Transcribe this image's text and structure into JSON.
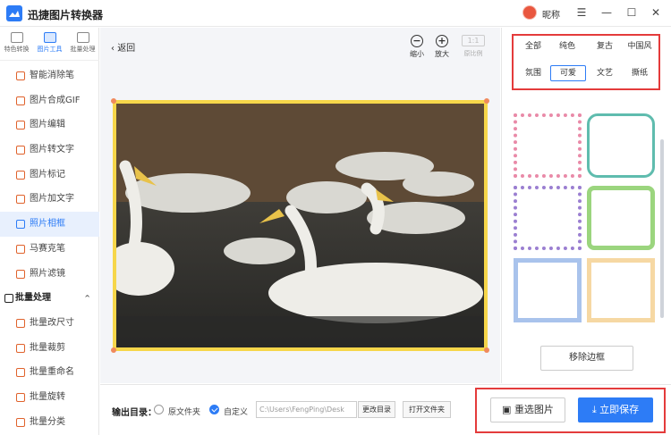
{
  "app": {
    "title": "迅捷图片转换器",
    "nickname": "昵称"
  },
  "window": {
    "menu_icon": "☰",
    "minimize_icon": "—",
    "maximize_icon": "☐",
    "close_icon": "✕"
  },
  "topnav": [
    {
      "label": "特色转换",
      "icon": "convert-icon"
    },
    {
      "label": "图片工具",
      "icon": "tools-icon"
    },
    {
      "label": "批量处理",
      "icon": "batch-icon"
    }
  ],
  "sidebar": {
    "items": [
      {
        "label": "智能消除笔"
      },
      {
        "label": "图片合成GIF"
      },
      {
        "label": "图片编辑"
      },
      {
        "label": "图片转文字"
      },
      {
        "label": "图片标记"
      },
      {
        "label": "图片加文字"
      },
      {
        "label": "照片相框"
      },
      {
        "label": "马赛克笔"
      },
      {
        "label": "照片滤镜"
      }
    ],
    "group": {
      "label": "批量处理",
      "chevron": "^"
    },
    "group_items": [
      {
        "label": "批量改尺寸"
      },
      {
        "label": "批量裁剪"
      },
      {
        "label": "批量重命名"
      },
      {
        "label": "批量旋转"
      },
      {
        "label": "批量分类"
      }
    ]
  },
  "main": {
    "back_label": "返回",
    "zoom_out_label": "缩小",
    "zoom_in_label": "放大",
    "ratio_label": "原比例",
    "ratio_button": "1:1"
  },
  "right_panel": {
    "categories": [
      "全部",
      "纯色",
      "复古",
      "中国风",
      "氛围",
      "可爱",
      "文艺",
      "撕纸"
    ],
    "active_category": "可爱",
    "remove_border_label": "移除边框"
  },
  "bottombar": {
    "output_label": "输出目录：",
    "option_original": "原文件夹",
    "option_custom": "自定义",
    "path_value": "C:\\Users\\FengPing\\Desk",
    "change_dir_label": "更改目录",
    "open_folder_label": "打开文件夹",
    "reselect_label": "重选图片",
    "save_label": "立即保存"
  },
  "colors": {
    "accent": "#2d7cf6",
    "highlight_box": "#e43b3b",
    "frame_yellow": "#f6d64a"
  }
}
